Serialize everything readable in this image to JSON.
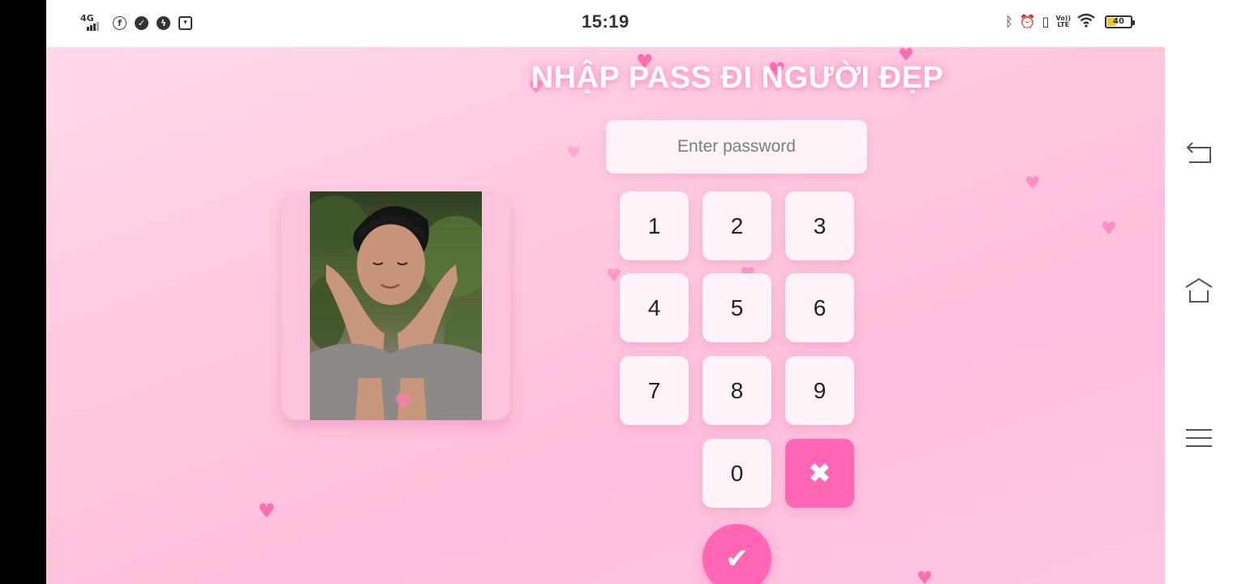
{
  "status_bar": {
    "time": "15:19",
    "network_label": "4G",
    "battery_level": "40",
    "battery_fraction": 0.4,
    "volte_top": "Vo))",
    "volte_bottom": "LTE",
    "left_icons": [
      "network-4g-icon",
      "facebook-icon",
      "check-circle-icon",
      "messenger-icon",
      "gallery-icon"
    ],
    "right_icons": [
      "bluetooth-icon",
      "alarm-icon",
      "vibrate-icon",
      "volte-icon",
      "wifi-icon",
      "battery-icon"
    ]
  },
  "app": {
    "title": "NHẬP PASS ĐI NGƯỜI ĐẸP",
    "password": {
      "placeholder": "Enter password",
      "value": ""
    },
    "keypad": {
      "keys": [
        "1",
        "2",
        "3",
        "4",
        "5",
        "6",
        "7",
        "8",
        "9",
        "0"
      ],
      "delete_symbol": "✖",
      "submit_symbol": "✔"
    }
  },
  "colors": {
    "background": "#ffc9e0",
    "accent": "#ff66b4",
    "key_background": "#fdf3f8",
    "title": "#ffffff"
  },
  "nav": {
    "buttons": [
      "back-icon",
      "home-icon",
      "menu-icon"
    ]
  }
}
